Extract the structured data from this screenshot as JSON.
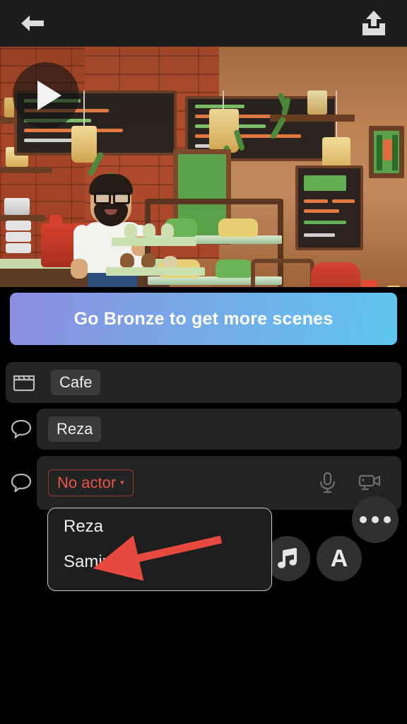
{
  "topbar": {
    "back_icon": "back-arrow-icon",
    "share_icon": "share-export-icon"
  },
  "preview": {
    "play_icon": "play-icon",
    "scene_description": "Cafe"
  },
  "cta": {
    "label": "Go Bronze to get more scenes",
    "gradient_from": "#8d8ee0",
    "gradient_to": "#5ec6ef"
  },
  "rows": [
    {
      "icon": "clapperboard-icon",
      "chip_label": "Cafe",
      "type": "scene"
    },
    {
      "icon": "speech-bubble-icon",
      "chip_label": "Reza",
      "type": "dialogue"
    },
    {
      "icon": "speech-bubble-icon",
      "chip_label": "No actor",
      "caret": "▾",
      "type": "dialogue",
      "state_color": "#e8554b",
      "mic_icon": "microphone-icon",
      "camera_icon": "video-camera-icon"
    }
  ],
  "fabs": {
    "more_label": "•••",
    "more_icon": "more-options-icon",
    "music_icon": "music-note-icon",
    "text_label": "A",
    "text_icon": "text-tool-icon"
  },
  "dropdown": {
    "items": [
      {
        "label": "Reza"
      },
      {
        "label": "Samir"
      }
    ]
  },
  "annotation": {
    "arrow_color": "#e8493f",
    "arrow_icon": "red-pointer-arrow"
  }
}
